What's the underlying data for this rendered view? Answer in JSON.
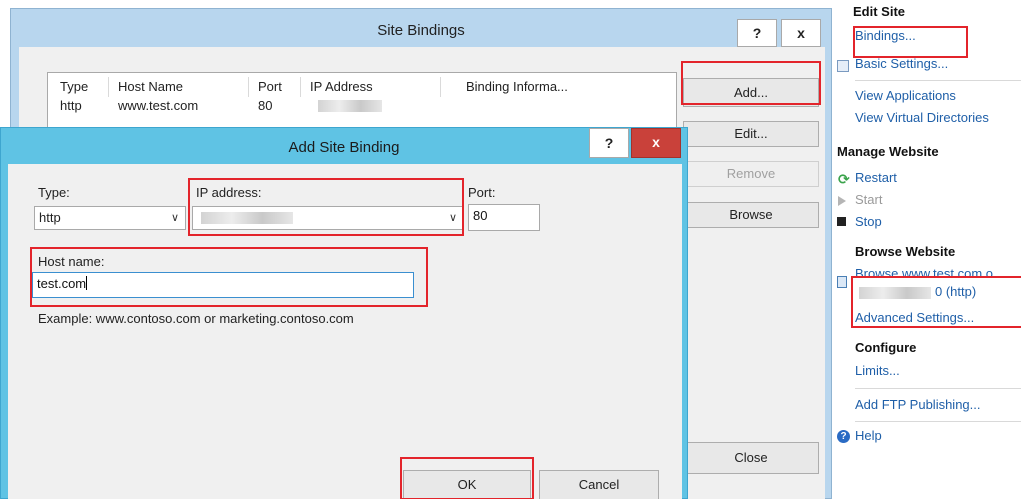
{
  "actions": {
    "edit_site": {
      "heading": "Edit Site",
      "bindings": "Bindings...",
      "basic_settings": "Basic Settings...",
      "view_applications": "View Applications",
      "view_virtual_directories": "View Virtual Directories"
    },
    "manage_website": {
      "heading": "Manage Website",
      "restart": "Restart",
      "start": "Start",
      "stop": "Stop"
    },
    "browse_website": {
      "heading": "Browse Website",
      "browse_link": "Browse www.test.com o",
      "browse_suffix": "0 (http)",
      "advanced_settings": "Advanced Settings..."
    },
    "configure": {
      "heading": "Configure",
      "limits": "Limits..."
    },
    "add_ftp": "Add FTP Publishing...",
    "help": "Help"
  },
  "site_bindings": {
    "title": "Site Bindings",
    "help_button": "?",
    "close_button": "x",
    "columns": [
      "Type",
      "Host Name",
      "Port",
      "IP Address",
      "Binding Informa..."
    ],
    "rows": [
      {
        "type": "http",
        "host": "www.test.com",
        "port": "80"
      }
    ],
    "buttons": {
      "add": "Add...",
      "edit": "Edit...",
      "remove": "Remove",
      "browse": "Browse",
      "close": "Close"
    }
  },
  "add_site_binding": {
    "title": "Add Site Binding",
    "help_button": "?",
    "close_button": "x",
    "type_label": "Type:",
    "type_value": "http",
    "ip_label": "IP address:",
    "port_label": "Port:",
    "port_value": "80",
    "host_label": "Host name:",
    "host_value": "test.com",
    "example": "Example: www.contoso.com or marketing.contoso.com",
    "ok": "OK",
    "cancel": "Cancel"
  },
  "colors": {
    "highlight": "#e3242b",
    "link": "#1f5fa8",
    "dialog_frame": "#5fc3e4",
    "back_frame": "#b8d6ee"
  }
}
